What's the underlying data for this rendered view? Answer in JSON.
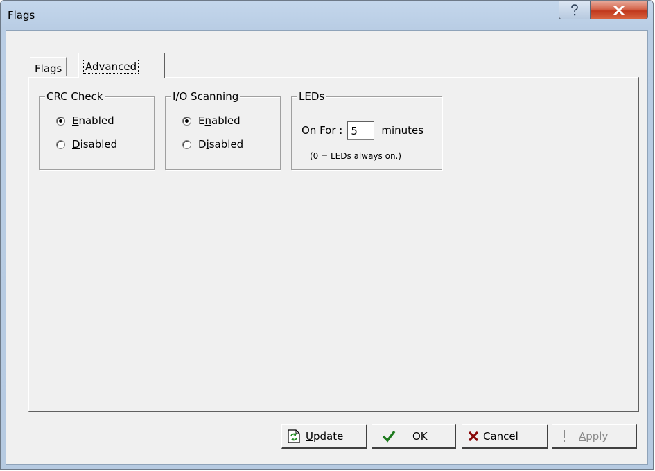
{
  "window": {
    "title": "Flags"
  },
  "tabs": [
    {
      "label": "Flags",
      "selected": false
    },
    {
      "label": "Advanced",
      "selected": true
    }
  ],
  "crc_check": {
    "title": "CRC Check",
    "options": [
      {
        "pre": "",
        "key": "E",
        "post": "nabled",
        "checked": true
      },
      {
        "pre": "",
        "key": "D",
        "post": "isabled",
        "checked": false
      }
    ]
  },
  "io_scanning": {
    "title": "I/O Scanning",
    "options": [
      {
        "pre": "E",
        "key": "n",
        "post": "abled",
        "checked": true
      },
      {
        "pre": "D",
        "key": "i",
        "post": "sabled",
        "checked": false
      }
    ]
  },
  "leds": {
    "title": "LEDs",
    "on_for_key": "O",
    "on_for_rest": "n For :",
    "on_for_value": "5",
    "unit": "minutes",
    "note": "(0 = LEDs always on.)"
  },
  "buttons": {
    "update": {
      "key": "U",
      "rest": "pdate",
      "icon": "refresh-icon"
    },
    "ok": {
      "label": "OK",
      "icon": "checkmark-icon",
      "color": "#1e7a1e"
    },
    "cancel": {
      "label": "Cancel",
      "icon": "x-icon",
      "color": "#7a0000"
    },
    "apply": {
      "key": "A",
      "rest": "pply",
      "icon": "exclamation-icon",
      "disabled": true
    }
  }
}
